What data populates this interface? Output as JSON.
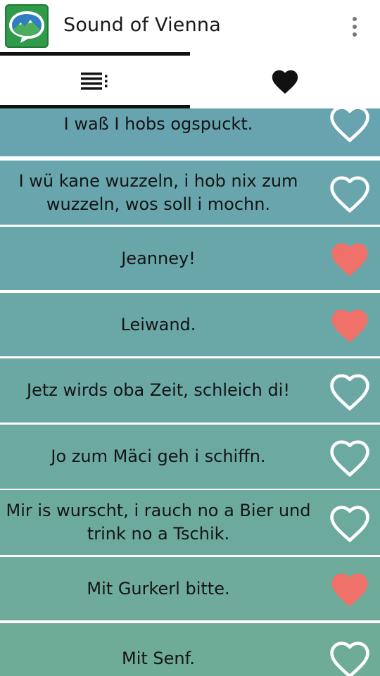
{
  "app": {
    "title": "Sound of Vienna",
    "icon": "app-logo-speech-bubble-icon"
  },
  "tabs": [
    {
      "name": "list",
      "icon": "list-icon",
      "selected": true
    },
    {
      "name": "favorites",
      "icon": "heart-icon",
      "selected": false
    }
  ],
  "colors": {
    "favorite_heart": "#f0706a",
    "outline_heart": "#ffffff",
    "row_top": "#67a4b0",
    "row_bottom": "#6fac98"
  },
  "phrases": [
    {
      "text": "I waß I hobs ogspuckt.",
      "favorite": false
    },
    {
      "text": "I wü kane wuzzeln, i hob nix zum wuzzeln, wos soll i mochn.",
      "favorite": false
    },
    {
      "text": "Jeanney!",
      "favorite": true
    },
    {
      "text": "Leiwand.",
      "favorite": true
    },
    {
      "text": "Jetz wirds oba Zeit, schleich di!",
      "favorite": false
    },
    {
      "text": "Jo zum Mäci geh i schiffn.",
      "favorite": false
    },
    {
      "text": "Mir is wurscht, i rauch no a Bier und trink no a Tschik.",
      "favorite": false
    },
    {
      "text": "Mit Gurkerl bitte.",
      "favorite": true
    },
    {
      "text": "Mit Senf.",
      "favorite": false
    }
  ]
}
